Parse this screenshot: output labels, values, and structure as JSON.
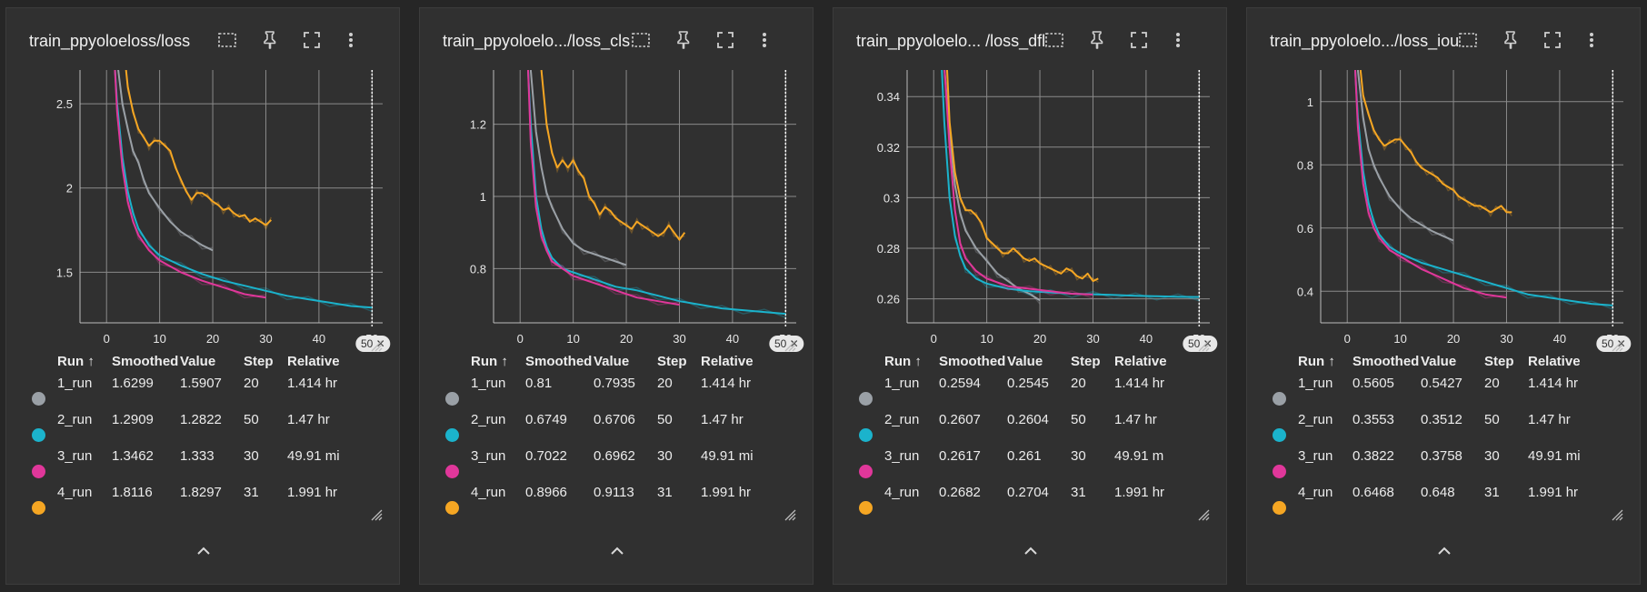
{
  "colors": {
    "run1": "#9aa0a6",
    "run2": "#1bb3cc",
    "run3": "#e0379a",
    "run4": "#f5a623"
  },
  "icons": [
    "fit-domain-icon",
    "pin-icon",
    "fullscreen-icon",
    "more-vert-icon",
    "resize-handle-icon",
    "collapse-chevron-icon"
  ],
  "table_headers": {
    "run": "Run ↑",
    "smoothed": "Smoothed",
    "value": "Value",
    "step": "Step",
    "relative": "Relative"
  },
  "zoom_label": "50 ✕",
  "cards": [
    {
      "title": "train_ppyoloeloss/loss",
      "rows": [
        {
          "run": "1_run",
          "smoothed": "1.6299",
          "value": "1.5907",
          "step": "20",
          "relative": "1.414 hr"
        },
        {
          "run": "2_run",
          "smoothed": "1.2909",
          "value": "1.2822",
          "step": "50",
          "relative": "1.47 hr"
        },
        {
          "run": "3_run",
          "smoothed": "1.3462",
          "value": "1.333",
          "step": "30",
          "relative": "49.91 mi"
        },
        {
          "run": "4_run",
          "smoothed": "1.8116",
          "value": "1.8297",
          "step": "31",
          "relative": "1.991 hr"
        }
      ]
    },
    {
      "title": "train_ppyoloelo.../loss_cls",
      "rows": [
        {
          "run": "1_run",
          "smoothed": "0.81",
          "value": "0.7935",
          "step": "20",
          "relative": "1.414 hr"
        },
        {
          "run": "2_run",
          "smoothed": "0.6749",
          "value": "0.6706",
          "step": "50",
          "relative": "1.47 hr"
        },
        {
          "run": "3_run",
          "smoothed": "0.7022",
          "value": "0.6962",
          "step": "30",
          "relative": "49.91 mi"
        },
        {
          "run": "4_run",
          "smoothed": "0.8966",
          "value": "0.9113",
          "step": "31",
          "relative": "1.991 hr"
        }
      ]
    },
    {
      "title": "train_ppyoloelo... /loss_dfl",
      "rows": [
        {
          "run": "1_run",
          "smoothed": "0.2594",
          "value": "0.2545",
          "step": "20",
          "relative": "1.414 hr"
        },
        {
          "run": "2_run",
          "smoothed": "0.2607",
          "value": "0.2604",
          "step": "50",
          "relative": "1.47 hr"
        },
        {
          "run": "3_run",
          "smoothed": "0.2617",
          "value": "0.261",
          "step": "30",
          "relative": "49.91 m"
        },
        {
          "run": "4_run",
          "smoothed": "0.2682",
          "value": "0.2704",
          "step": "31",
          "relative": "1.991 hr"
        }
      ]
    },
    {
      "title": "train_ppyoloelo.../loss_iou",
      "rows": [
        {
          "run": "1_run",
          "smoothed": "0.5605",
          "value": "0.5427",
          "step": "20",
          "relative": "1.414 hr"
        },
        {
          "run": "2_run",
          "smoothed": "0.3553",
          "value": "0.3512",
          "step": "50",
          "relative": "1.47 hr"
        },
        {
          "run": "3_run",
          "smoothed": "0.3822",
          "value": "0.3758",
          "step": "30",
          "relative": "49.91 mi"
        },
        {
          "run": "4_run",
          "smoothed": "0.6468",
          "value": "0.648",
          "step": "31",
          "relative": "1.991 hr"
        }
      ]
    }
  ],
  "chart_data": [
    {
      "type": "line",
      "title": "train_ppyoloeloss/loss",
      "xlim": [
        -5,
        52
      ],
      "ylim": [
        1.2,
        2.7
      ],
      "xticks": [
        "0",
        "10",
        "20",
        "30",
        "40",
        "50"
      ],
      "yticks": [
        {
          "v": 1.5,
          "label": "1.5"
        },
        {
          "v": 2,
          "label": "2"
        },
        {
          "v": 2.5,
          "label": "2.5"
        }
      ],
      "grid": true,
      "series": [
        {
          "name": "1_run",
          "color": "#9aa0a6",
          "x": [
            2,
            3,
            4,
            5,
            6,
            7,
            8,
            10,
            12,
            14,
            16,
            18,
            20
          ],
          "y": [
            2.75,
            2.5,
            2.35,
            2.22,
            2.15,
            2.05,
            1.97,
            1.88,
            1.8,
            1.74,
            1.7,
            1.66,
            1.63
          ]
        },
        {
          "name": "2_run",
          "color": "#1bb3cc",
          "x": [
            1.5,
            2,
            3,
            4,
            5,
            6,
            8,
            10,
            14,
            18,
            22,
            26,
            30,
            34,
            38,
            42,
            46,
            50
          ],
          "y": [
            2.75,
            2.5,
            2.18,
            1.98,
            1.85,
            1.76,
            1.66,
            1.6,
            1.54,
            1.49,
            1.45,
            1.42,
            1.39,
            1.36,
            1.34,
            1.32,
            1.3,
            1.29
          ]
        },
        {
          "name": "3_run",
          "color": "#e0379a",
          "x": [
            1.5,
            2,
            3,
            4,
            5,
            6,
            8,
            10,
            14,
            18,
            22,
            26,
            30
          ],
          "y": [
            2.75,
            2.45,
            2.12,
            1.92,
            1.8,
            1.72,
            1.63,
            1.57,
            1.5,
            1.45,
            1.41,
            1.37,
            1.35
          ]
        },
        {
          "name": "4_run",
          "color": "#f5a623",
          "x": [
            3.5,
            4,
            5,
            6,
            7,
            8,
            9,
            10,
            11,
            12,
            13,
            14,
            15,
            16,
            17,
            18,
            19,
            20,
            21,
            22,
            23,
            24,
            25,
            26,
            27,
            28,
            29,
            30,
            31
          ],
          "y": [
            2.75,
            2.6,
            2.45,
            2.35,
            2.3,
            2.25,
            2.28,
            2.28,
            2.25,
            2.22,
            2.12,
            2.05,
            1.98,
            1.93,
            1.97,
            1.97,
            1.95,
            1.92,
            1.9,
            1.87,
            1.88,
            1.85,
            1.83,
            1.84,
            1.8,
            1.82,
            1.8,
            1.78,
            1.81
          ]
        }
      ]
    },
    {
      "type": "line",
      "title": "train_ppyoloelo.../loss_cls",
      "xlim": [
        -5,
        52
      ],
      "ylim": [
        0.65,
        1.35
      ],
      "xticks": [
        "0",
        "10",
        "20",
        "30",
        "40",
        "50"
      ],
      "yticks": [
        {
          "v": 0.8,
          "label": "0.8"
        },
        {
          "v": 1,
          "label": "1"
        },
        {
          "v": 1.2,
          "label": "1.2"
        }
      ],
      "grid": true,
      "series": [
        {
          "name": "1_run",
          "color": "#9aa0a6",
          "x": [
            2,
            3,
            4,
            5,
            6,
            8,
            10,
            12,
            14,
            16,
            18,
            20
          ],
          "y": [
            1.35,
            1.18,
            1.08,
            1.01,
            0.97,
            0.91,
            0.87,
            0.85,
            0.84,
            0.83,
            0.82,
            0.81
          ]
        },
        {
          "name": "2_run",
          "color": "#1bb3cc",
          "x": [
            1.5,
            2,
            3,
            4,
            5,
            6,
            8,
            10,
            14,
            18,
            22,
            26,
            30,
            34,
            38,
            42,
            46,
            50
          ],
          "y": [
            1.35,
            1.2,
            1.0,
            0.91,
            0.86,
            0.83,
            0.8,
            0.79,
            0.77,
            0.75,
            0.74,
            0.725,
            0.71,
            0.7,
            0.69,
            0.685,
            0.68,
            0.675
          ]
        },
        {
          "name": "3_run",
          "color": "#e0379a",
          "x": [
            1.5,
            2,
            3,
            4,
            5,
            6,
            8,
            10,
            14,
            18,
            22,
            26,
            30
          ],
          "y": [
            1.35,
            1.15,
            0.97,
            0.89,
            0.85,
            0.82,
            0.8,
            0.78,
            0.76,
            0.74,
            0.72,
            0.71,
            0.7
          ]
        },
        {
          "name": "4_run",
          "color": "#f5a623",
          "x": [
            4,
            5,
            6,
            7,
            8,
            9,
            10,
            11,
            12,
            13,
            14,
            15,
            16,
            17,
            18,
            19,
            20,
            21,
            22,
            23,
            24,
            25,
            26,
            27,
            28,
            29,
            30,
            31
          ],
          "y": [
            1.35,
            1.2,
            1.12,
            1.08,
            1.1,
            1.08,
            1.1,
            1.07,
            1.05,
            1.0,
            0.98,
            0.95,
            0.97,
            0.96,
            0.94,
            0.93,
            0.92,
            0.91,
            0.93,
            0.92,
            0.91,
            0.9,
            0.89,
            0.9,
            0.92,
            0.9,
            0.88,
            0.9
          ]
        }
      ]
    },
    {
      "type": "line",
      "title": "train_ppyoloelo... /loss_dfl",
      "xlim": [
        -5,
        52
      ],
      "ylim": [
        0.2505,
        0.3505
      ],
      "xticks": [
        "0",
        "10",
        "20",
        "30",
        "40",
        "50"
      ],
      "yticks": [
        {
          "v": 0.26,
          "label": "0.26"
        },
        {
          "v": 0.28,
          "label": "0.28"
        },
        {
          "v": 0.3,
          "label": "0.3"
        },
        {
          "v": 0.32,
          "label": "0.32"
        },
        {
          "v": 0.34,
          "label": "0.34"
        }
      ],
      "grid": true,
      "series": [
        {
          "name": "1_run",
          "color": "#9aa0a6",
          "x": [
            2,
            3,
            4,
            5,
            6,
            8,
            10,
            12,
            14,
            16,
            18,
            20
          ],
          "y": [
            0.352,
            0.325,
            0.305,
            0.294,
            0.287,
            0.28,
            0.275,
            0.27,
            0.267,
            0.264,
            0.262,
            0.2594
          ]
        },
        {
          "name": "2_run",
          "color": "#1bb3cc",
          "x": [
            1.5,
            2,
            3,
            4,
            5,
            6,
            8,
            10,
            14,
            18,
            22,
            26,
            30,
            34,
            38,
            42,
            46,
            50
          ],
          "y": [
            0.352,
            0.33,
            0.3,
            0.285,
            0.277,
            0.272,
            0.268,
            0.266,
            0.264,
            0.263,
            0.2625,
            0.262,
            0.2618,
            0.2615,
            0.2612,
            0.261,
            0.2608,
            0.2607
          ]
        },
        {
          "name": "3_run",
          "color": "#e0379a",
          "x": [
            2,
            3,
            4,
            5,
            6,
            8,
            10,
            14,
            18,
            22,
            26,
            30
          ],
          "y": [
            0.352,
            0.32,
            0.295,
            0.282,
            0.276,
            0.271,
            0.268,
            0.265,
            0.264,
            0.263,
            0.262,
            0.2617
          ]
        },
        {
          "name": "4_run",
          "color": "#f5a623",
          "x": [
            2.5,
            3,
            4,
            5,
            6,
            7,
            8,
            9,
            10,
            11,
            12,
            13,
            14,
            15,
            16,
            17,
            18,
            19,
            20,
            21,
            22,
            23,
            24,
            25,
            26,
            27,
            28,
            29,
            30,
            31
          ],
          "y": [
            0.352,
            0.33,
            0.31,
            0.3,
            0.295,
            0.295,
            0.293,
            0.29,
            0.284,
            0.282,
            0.28,
            0.278,
            0.278,
            0.28,
            0.278,
            0.276,
            0.275,
            0.276,
            0.274,
            0.273,
            0.272,
            0.271,
            0.27,
            0.272,
            0.271,
            0.269,
            0.268,
            0.27,
            0.267,
            0.268
          ]
        }
      ]
    },
    {
      "type": "line",
      "title": "train_ppyoloelo.../loss_iou",
      "xlim": [
        -5,
        52
      ],
      "ylim": [
        0.3,
        1.1
      ],
      "xticks": [
        "0",
        "10",
        "20",
        "30",
        "40",
        "50"
      ],
      "yticks": [
        {
          "v": 0.4,
          "label": "0.4"
        },
        {
          "v": 0.6,
          "label": "0.6"
        },
        {
          "v": 0.8,
          "label": "0.8"
        },
        {
          "v": 1,
          "label": "1"
        }
      ],
      "grid": true,
      "series": [
        {
          "name": "1_run",
          "color": "#9aa0a6",
          "x": [
            2,
            3,
            4,
            5,
            6,
            8,
            10,
            12,
            14,
            16,
            18,
            20
          ],
          "y": [
            1.1,
            0.95,
            0.85,
            0.8,
            0.76,
            0.7,
            0.66,
            0.63,
            0.61,
            0.59,
            0.575,
            0.56
          ]
        },
        {
          "name": "2_run",
          "color": "#1bb3cc",
          "x": [
            1.5,
            2,
            3,
            4,
            5,
            6,
            8,
            10,
            14,
            18,
            22,
            26,
            30,
            34,
            38,
            42,
            46,
            50
          ],
          "y": [
            1.1,
            0.95,
            0.78,
            0.68,
            0.62,
            0.58,
            0.54,
            0.52,
            0.49,
            0.47,
            0.45,
            0.43,
            0.41,
            0.39,
            0.38,
            0.37,
            0.36,
            0.355
          ]
        },
        {
          "name": "3_run",
          "color": "#e0379a",
          "x": [
            1.5,
            2,
            3,
            4,
            5,
            6,
            8,
            10,
            14,
            18,
            22,
            26,
            30
          ],
          "y": [
            1.1,
            0.92,
            0.74,
            0.65,
            0.6,
            0.57,
            0.53,
            0.51,
            0.47,
            0.44,
            0.41,
            0.39,
            0.38
          ]
        },
        {
          "name": "4_run",
          "color": "#f5a623",
          "x": [
            2.5,
            3,
            4,
            5,
            6,
            7,
            8,
            9,
            10,
            11,
            12,
            13,
            14,
            15,
            16,
            17,
            18,
            19,
            20,
            21,
            22,
            23,
            24,
            25,
            26,
            27,
            28,
            29,
            30,
            31
          ],
          "y": [
            1.1,
            1.02,
            0.96,
            0.91,
            0.88,
            0.86,
            0.87,
            0.88,
            0.88,
            0.86,
            0.84,
            0.81,
            0.79,
            0.78,
            0.77,
            0.76,
            0.74,
            0.73,
            0.72,
            0.7,
            0.69,
            0.68,
            0.67,
            0.67,
            0.66,
            0.65,
            0.66,
            0.67,
            0.65,
            0.65
          ]
        }
      ]
    }
  ]
}
